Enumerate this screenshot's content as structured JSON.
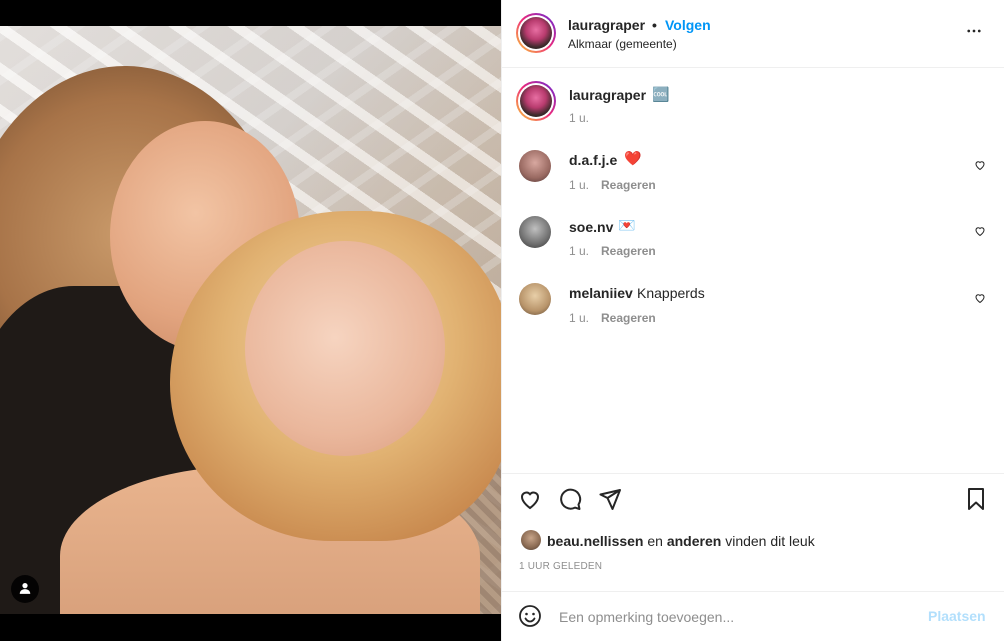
{
  "post": {
    "username": "lauragraper",
    "separator": "•",
    "follow_label": "Volgen",
    "location": "Alkmaar (gemeente)"
  },
  "caption": {
    "username": "lauragraper",
    "text": "🆒",
    "time": "1 u."
  },
  "comments": [
    {
      "username": "d.a.f.j.e",
      "text": "❤️",
      "time": "1 u.",
      "reply_label": "Reageren"
    },
    {
      "username": "soe.nv",
      "text": "💌",
      "time": "1 u.",
      "reply_label": "Reageren"
    },
    {
      "username": "melaniiev",
      "text": "Knapperds",
      "time": "1 u.",
      "reply_label": "Reageren"
    }
  ],
  "likes": {
    "first_user": "beau.nellissen",
    "joiner": " en ",
    "others": "anderen",
    "suffix": " vinden dit leuk"
  },
  "posted_ago": "1 UUR GELEDEN",
  "composer": {
    "placeholder": "Een opmerking toevoegen...",
    "post_label": "Plaatsen"
  },
  "icons": {
    "more": "more-horizontal-icon",
    "like": "heart-icon",
    "comment": "comment-bubble-icon",
    "share": "paper-plane-icon",
    "save": "bookmark-icon",
    "emoji": "emoji-icon",
    "tag": "user-tag-icon"
  },
  "colors": {
    "accent": "#0095f6",
    "post_disabled": "#b2dffc",
    "muted": "#8e8e8e",
    "text": "#262626"
  }
}
